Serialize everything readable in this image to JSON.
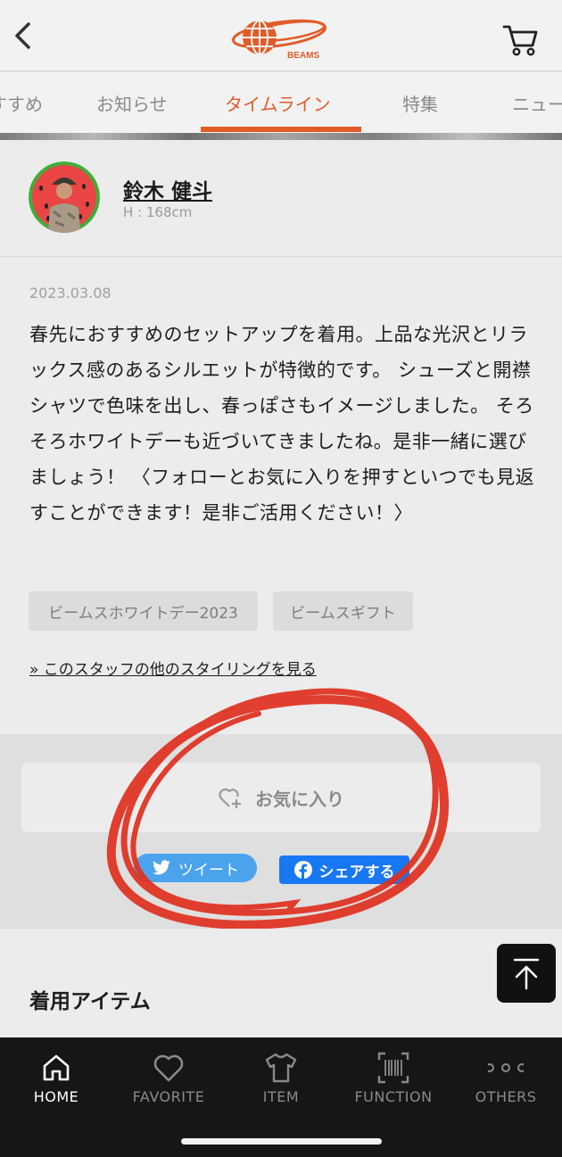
{
  "header": {
    "logo_text": "BEAMS",
    "back_icon": "chevron-left-icon",
    "cart_icon": "cart-icon"
  },
  "tabs": [
    {
      "label": "すすめ"
    },
    {
      "label": "お知らせ"
    },
    {
      "label": "タイムライン",
      "active": true
    },
    {
      "label": "特集"
    },
    {
      "label": "ニュー"
    }
  ],
  "staff": {
    "name": "鈴木 健斗",
    "height": "H : 168cm"
  },
  "post": {
    "date": "2023.03.08",
    "body": "春先におすすめのセットアップを着用。上品な光沢とリラックス感のあるシルエットが特徴的です。 シューズと開襟シャツで色味を出し、春っぽさもイメージしました。 そろそろホワイトデーも近づいてきましたね。是非一緒に選びましょう！ 〈フォローとお気に入りを押すといつでも見返すことができます！是非ご活用ください！〉",
    "tags": [
      "ビームスホワイトデー2023",
      "ビームスギフト"
    ],
    "more_link": "» このスタッフの他のスタイリングを見る"
  },
  "actions": {
    "favorite_label": "お気に入り",
    "tweet_label": "ツイート",
    "share_label": "シェアする"
  },
  "items": {
    "heading": "着用アイテム"
  },
  "nav": [
    {
      "label": "HOME",
      "icon": "home-icon",
      "active": true
    },
    {
      "label": "FAVORITE",
      "icon": "heart-icon"
    },
    {
      "label": "ITEM",
      "icon": "tshirt-icon"
    },
    {
      "label": "FUNCTION",
      "icon": "barcode-scan-icon"
    },
    {
      "label": "OTHERS",
      "icon": "more-dots-icon"
    }
  ],
  "colors": {
    "accent": "#e15c28",
    "twitter": "#4ba3ec",
    "facebook": "#1877f2",
    "annotation": "#e0301e"
  }
}
